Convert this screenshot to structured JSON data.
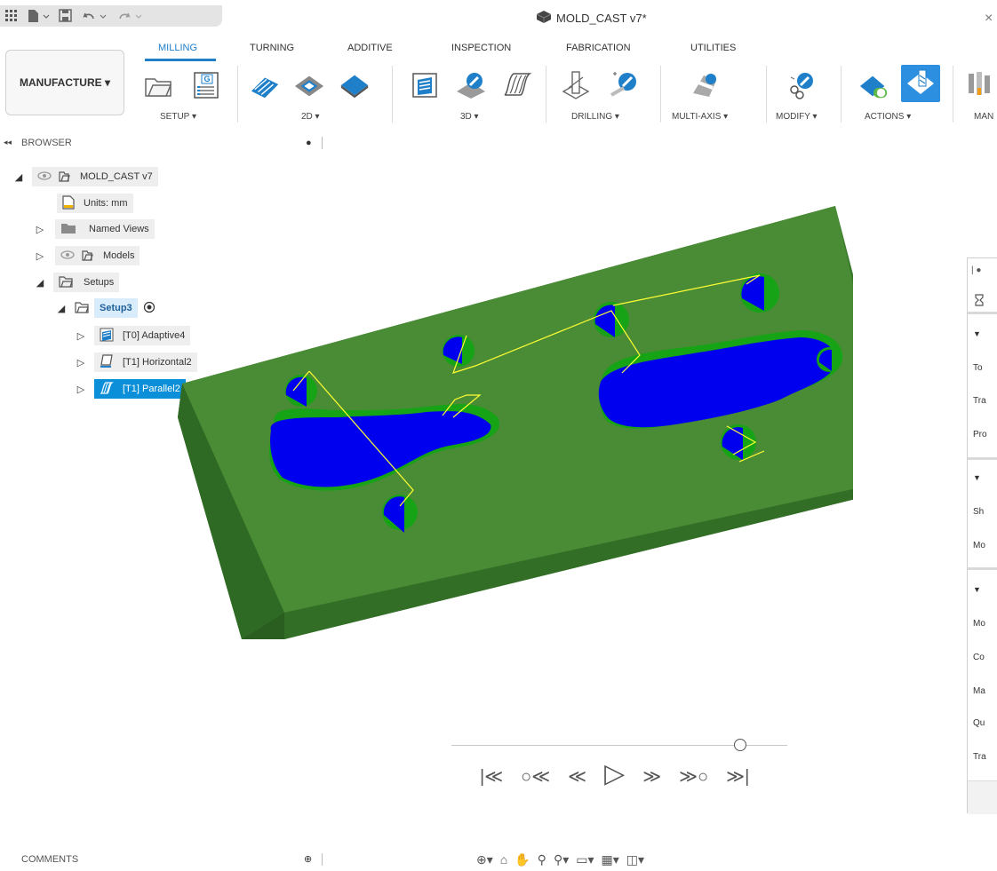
{
  "window": {
    "document_title": "MOLD_CAST v7*",
    "close_glyph": "×"
  },
  "tabs": [
    "MILLING",
    "TURNING",
    "ADDITIVE",
    "INSPECTION",
    "FABRICATION",
    "UTILITIES"
  ],
  "workspace": {
    "label": "MANUFACTURE ▾"
  },
  "groups": {
    "setup": "SETUP ▾",
    "twod": "2D ▾",
    "threed": "3D ▾",
    "drilling": "DRILLING ▾",
    "multiaxis": "MULTI-AXIS ▾",
    "modify": "MODIFY ▾",
    "actions": "ACTIONS ▾",
    "manage_partial": "MAN"
  },
  "browser": {
    "collapse_glyph": "◂◂",
    "title": "BROWSER",
    "root": "MOLD_CAST v7",
    "units": "Units: mm",
    "named_views": "Named Views",
    "models": "Models",
    "setups": "Setups",
    "setup3": "Setup3",
    "ops": [
      "[T0] Adaptive4",
      "[T1] Horizontal2",
      "[T1] Parallel2"
    ]
  },
  "right_panel": {
    "rows": [
      "To",
      "Tra",
      "Pro",
      "Sh",
      "Mo",
      "Mo",
      "Co",
      "Ma",
      "Qu",
      "Tra"
    ]
  },
  "playback": {
    "controls": [
      "|≪",
      "○≪",
      "≪",
      "▷",
      "≫",
      "≫○",
      "≫|"
    ]
  },
  "comments": {
    "title": "COMMENTS"
  },
  "colors": {
    "accent": "#1f7fc9",
    "stock_green": "#3f7d2e",
    "cavity_blue": "#0a0af0",
    "toolpath_yellow": "#ffff33"
  }
}
